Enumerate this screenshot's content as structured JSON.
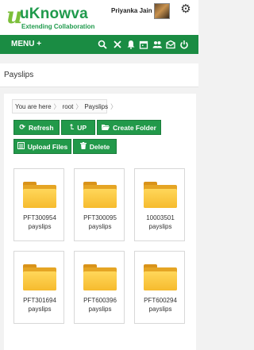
{
  "header": {
    "logo_name": "uKnowva",
    "logo_tagline": "Extending Collaboration",
    "user_name": "Priyanka Jain"
  },
  "menubar": {
    "menu_label": "MENU +",
    "icons": [
      "search-icon",
      "tools-icon",
      "bell-icon",
      "calendar-icon",
      "users-icon",
      "mail-icon",
      "power-icon"
    ]
  },
  "page": {
    "title": "Payslips"
  },
  "breadcrumb": {
    "prefix": "You are here",
    "items": [
      "root",
      "Payslips"
    ]
  },
  "toolbar": {
    "refresh": "Refresh",
    "up": "UP",
    "create_folder": "Create Folder",
    "upload_files": "Upload Files",
    "delete": "Delete"
  },
  "folders": [
    {
      "line1": "PFT300954",
      "line2": "payslips"
    },
    {
      "line1": "PFT300095",
      "line2": "payslips"
    },
    {
      "line1": "10003501",
      "line2": "payslips"
    },
    {
      "line1": "PFT301694",
      "line2": "payslips"
    },
    {
      "line1": "PFT600396",
      "line2": "payslips"
    },
    {
      "line1": "PFT600294",
      "line2": "payslips"
    }
  ]
}
